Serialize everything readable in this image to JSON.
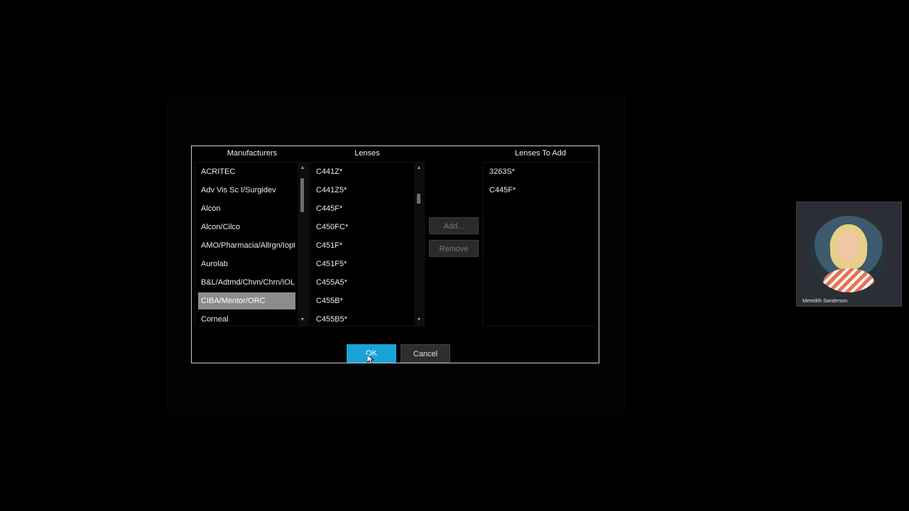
{
  "dialog": {
    "headers": {
      "manufacturers": "Manufacturers",
      "lenses": "Lenses",
      "lenses_to_add": "Lenses To Add"
    },
    "manufacturers": [
      "ACRITEC",
      "Adv Vis Sc I/Surgidev",
      "Alcon",
      "Alcon/Cilco",
      "AMO/Pharmacia/Allrgn/Ioptx",
      "Aurolab",
      "B&L/Adtmd/Chvn/Chrn/IOLB/I",
      "CIBA/Mentor/ORC",
      "Corneal"
    ],
    "selected_manufacturer": "CIBA/Mentor/ORC",
    "lenses": [
      "C441Z*",
      "C441Z5*",
      "C445F*",
      "C450FC*",
      "C451F*",
      "C451F5*",
      "C455A5*",
      "C455B*",
      "C455B5*"
    ],
    "lenses_to_add": [
      "3263S*",
      "C445F*"
    ],
    "buttons": {
      "add": "Add...",
      "remove": "Remove",
      "ok": "OK",
      "cancel": "Cancel"
    }
  },
  "video": {
    "participant_name": "Meredith Sanderson"
  },
  "colors": {
    "accent": "#1aa3d6",
    "selection": "#8c8c8c",
    "background": "#000000"
  }
}
